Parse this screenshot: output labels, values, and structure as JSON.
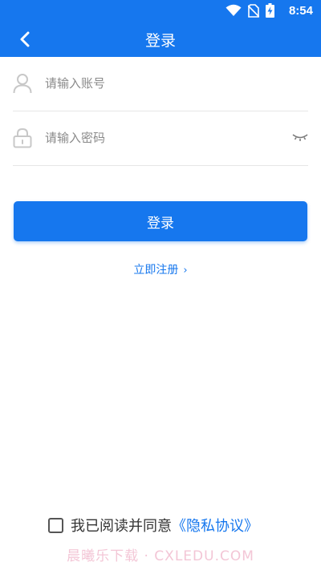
{
  "status_bar": {
    "time": "8:54",
    "icons": [
      "wifi-icon",
      "no-sim-icon",
      "battery-charging-icon"
    ]
  },
  "header": {
    "title": "登录",
    "back_icon": "chevron-left-icon"
  },
  "form": {
    "account_placeholder": "请输入账号",
    "password_placeholder": "请输入密码",
    "account_icon": "user-icon",
    "password_icon": "lock-icon",
    "toggle_icon": "eye-closed-icon"
  },
  "actions": {
    "login_label": "登录",
    "register_label": "立即注册",
    "register_chevron": "›"
  },
  "agreement": {
    "text": "我已阅读并同意",
    "link": "《隐私协议》",
    "checked": false
  },
  "watermark": "晨曦乐下载 · CXLEDU.COM",
  "colors": {
    "primary": "#1677ee",
    "text": "#333333",
    "placeholder": "#8a8a8a",
    "divider": "#e6e6e6"
  }
}
